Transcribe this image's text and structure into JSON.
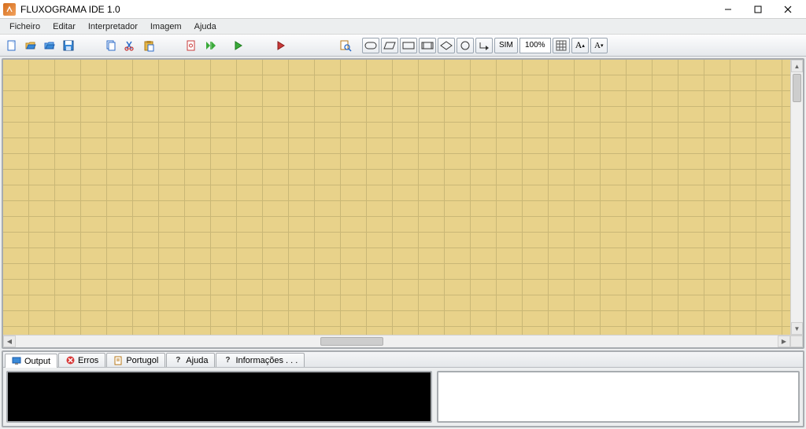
{
  "window": {
    "title": "FLUXOGRAMA IDE 1.0"
  },
  "menu": {
    "items": [
      "Ficheiro",
      "Editar",
      "Interpretador",
      "Imagem",
      "Ajuda"
    ]
  },
  "toolbar": {
    "new": "new-file",
    "open": "open-folder",
    "open2": "open-folder-alt",
    "save": "save",
    "copy": "copy",
    "cut": "cut",
    "paste": "paste",
    "settings": "settings",
    "run_step": "run-step",
    "run": "run",
    "stop": "stop",
    "find": "find",
    "shapes": {
      "terminal": "terminal-shape",
      "process": "process-shape",
      "io": "io-shape",
      "sub": "subprocess-shape",
      "decision": "decision-shape",
      "connector": "connector-shape",
      "arrow": "arrow-shape"
    },
    "sim_label": "SIM",
    "zoom_value": "100%",
    "grid": "grid-toggle",
    "font_inc": "A",
    "font_dec": "A"
  },
  "tabs": {
    "output": "Output",
    "erros": "Erros",
    "portugol": "Portugol",
    "ajuda": "Ajuda",
    "info": "Informações . . ."
  }
}
